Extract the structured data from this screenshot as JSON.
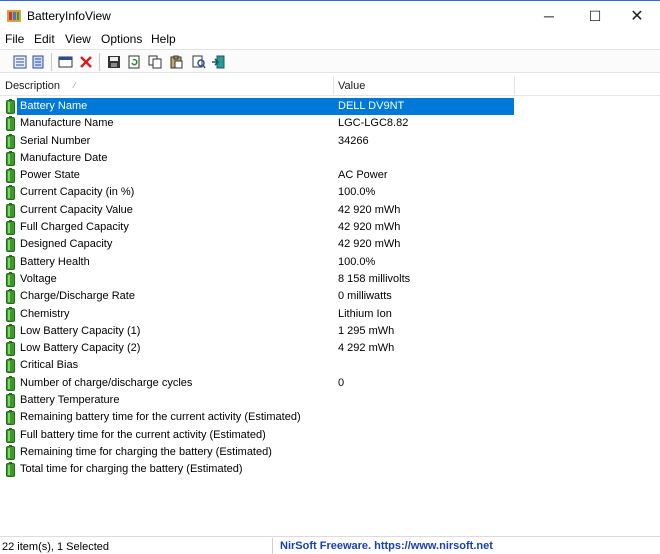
{
  "window": {
    "title": "BatteryInfoView",
    "min_glyph": "─",
    "max_glyph": "☐",
    "close_glyph": "✕"
  },
  "menu": [
    "File",
    "Edit",
    "View",
    "Options",
    "Help"
  ],
  "toolbar": {
    "icons": [
      "html-report-icon",
      "properties-icon",
      "display-icon",
      "delete-icon",
      "save-icon",
      "refresh-icon",
      "copy-icon",
      "paste-icon",
      "find-icon",
      "exit-icon"
    ]
  },
  "columns": {
    "description": "Description",
    "value": "Value"
  },
  "rows": [
    {
      "description": "Battery Name",
      "value": "DELL DV9NT",
      "selected": true
    },
    {
      "description": "Manufacture Name",
      "value": "LGC-LGC8.82"
    },
    {
      "description": "Serial Number",
      "value": "34266"
    },
    {
      "description": "Manufacture Date",
      "value": ""
    },
    {
      "description": "Power State",
      "value": "AC Power"
    },
    {
      "description": "Current Capacity (in %)",
      "value": "100.0%"
    },
    {
      "description": "Current Capacity Value",
      "value": "42 920 mWh"
    },
    {
      "description": "Full Charged Capacity",
      "value": "42 920 mWh"
    },
    {
      "description": "Designed Capacity",
      "value": "42 920 mWh"
    },
    {
      "description": "Battery Health",
      "value": "100.0%"
    },
    {
      "description": "Voltage",
      "value": "8 158 millivolts"
    },
    {
      "description": "Charge/Discharge Rate",
      "value": "0 milliwatts"
    },
    {
      "description": "Chemistry",
      "value": "Lithium Ion"
    },
    {
      "description": "Low Battery Capacity (1)",
      "value": "1 295 mWh"
    },
    {
      "description": "Low Battery Capacity (2)",
      "value": "4 292 mWh"
    },
    {
      "description": "Critical Bias",
      "value": ""
    },
    {
      "description": "Number of charge/discharge cycles",
      "value": "0"
    },
    {
      "description": "Battery Temperature",
      "value": ""
    },
    {
      "description": "Remaining battery time for the current activity (Estimated)",
      "value": ""
    },
    {
      "description": "Full battery time for the current activity (Estimated)",
      "value": ""
    },
    {
      "description": "Remaining time for charging the battery (Estimated)",
      "value": ""
    },
    {
      "description": "Total  time for charging the battery (Estimated)",
      "value": ""
    }
  ],
  "status": {
    "items": "22 item(s), 1 Selected",
    "credit": "NirSoft Freeware. https://www.nirsoft.net"
  },
  "colors": {
    "selection": "#0078d7",
    "battery_green": "#3a9a2a",
    "link_blue": "#1a3fb3"
  }
}
